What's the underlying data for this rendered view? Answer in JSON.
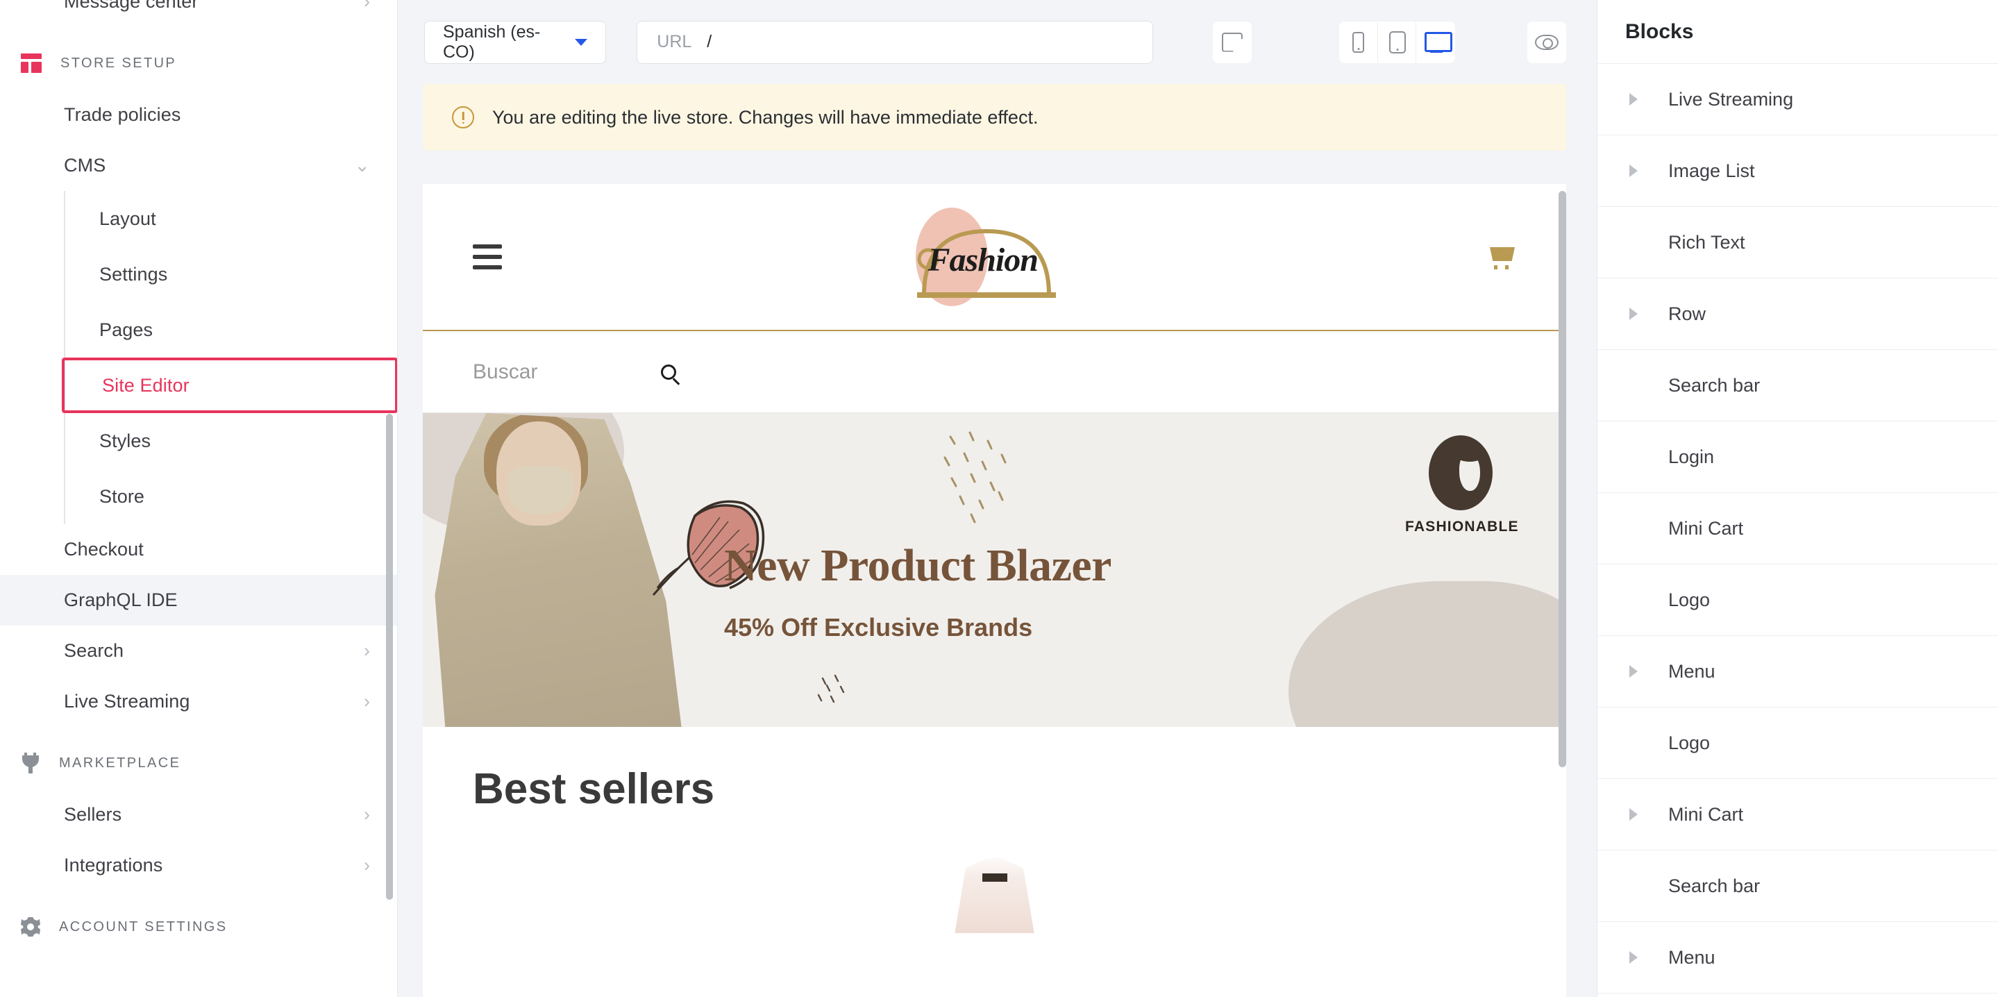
{
  "sidebar": {
    "items_top": [
      {
        "label": "Message center",
        "chevron": "right",
        "type": "item"
      }
    ],
    "sections": [
      {
        "title": "STORE SETUP",
        "icon": "store-icon",
        "items": [
          {
            "label": "Trade policies",
            "chevron": "",
            "type": "item"
          },
          {
            "label": "CMS",
            "chevron": "down",
            "type": "item",
            "expanded": true
          }
        ],
        "subitems": [
          {
            "label": "Layout",
            "selected": false
          },
          {
            "label": "Settings",
            "selected": false
          },
          {
            "label": "Pages",
            "selected": false
          },
          {
            "label": "Site Editor",
            "selected": true
          },
          {
            "label": "Styles",
            "selected": false
          },
          {
            "label": "Store",
            "selected": false
          }
        ],
        "items_after": [
          {
            "label": "Checkout",
            "chevron": "",
            "type": "item",
            "active": false
          },
          {
            "label": "GraphQL IDE",
            "chevron": "",
            "type": "item",
            "active": true
          },
          {
            "label": "Search",
            "chevron": "right",
            "type": "item"
          },
          {
            "label": "Live Streaming",
            "chevron": "right",
            "type": "item"
          }
        ]
      },
      {
        "title": "MARKETPLACE",
        "icon": "plug-icon",
        "items": [
          {
            "label": "Sellers",
            "chevron": "right",
            "type": "item"
          },
          {
            "label": "Integrations",
            "chevron": "right",
            "type": "item"
          }
        ]
      },
      {
        "title": "ACCOUNT SETTINGS",
        "icon": "gear-icon",
        "items": []
      }
    ],
    "accent_color": "#e8345c"
  },
  "toolbar": {
    "language": "Spanish (es-CO)",
    "url_label": "URL",
    "url_value": "/",
    "select_tool": "select-element",
    "devices": [
      {
        "name": "mobile",
        "active": false
      },
      {
        "name": "tablet",
        "active": false
      },
      {
        "name": "desktop",
        "active": true
      }
    ],
    "preview_label": "preview",
    "active_device_color": "#2458e6"
  },
  "banner": {
    "message": "You are editing the live store. Changes will have immediate effect.",
    "background": "#fdf6e3",
    "icon_color": "#c8973a"
  },
  "store_preview": {
    "header": {
      "menu_icon": "hamburger-icon",
      "logo_text": "Fashion",
      "cart_icon": "cart-icon",
      "logo_circle_color": "#f0c2b4",
      "logo_arc_color": "#b99a52"
    },
    "search": {
      "placeholder": "Buscar",
      "icon": "search-icon"
    },
    "hero": {
      "title": "New Product Blazer",
      "subtitle": "45% Off Exclusive Brands",
      "brand_label": "FASHIONABLE",
      "background": "#f1efec",
      "text_color": "#76543a"
    },
    "section": {
      "title": "Best sellers"
    }
  },
  "blocks": {
    "title": "Blocks",
    "items": [
      {
        "label": "Live Streaming",
        "expandable": true
      },
      {
        "label": "Image List",
        "expandable": true
      },
      {
        "label": "Rich Text",
        "expandable": false
      },
      {
        "label": "Row",
        "expandable": true
      },
      {
        "label": "Search bar",
        "expandable": false
      },
      {
        "label": "Login",
        "expandable": false
      },
      {
        "label": "Mini Cart",
        "expandable": false
      },
      {
        "label": "Logo",
        "expandable": false
      },
      {
        "label": "Menu",
        "expandable": true
      },
      {
        "label": "Logo",
        "expandable": false
      },
      {
        "label": "Mini Cart",
        "expandable": true
      },
      {
        "label": "Search bar",
        "expandable": false
      },
      {
        "label": "Menu",
        "expandable": true
      }
    ]
  }
}
